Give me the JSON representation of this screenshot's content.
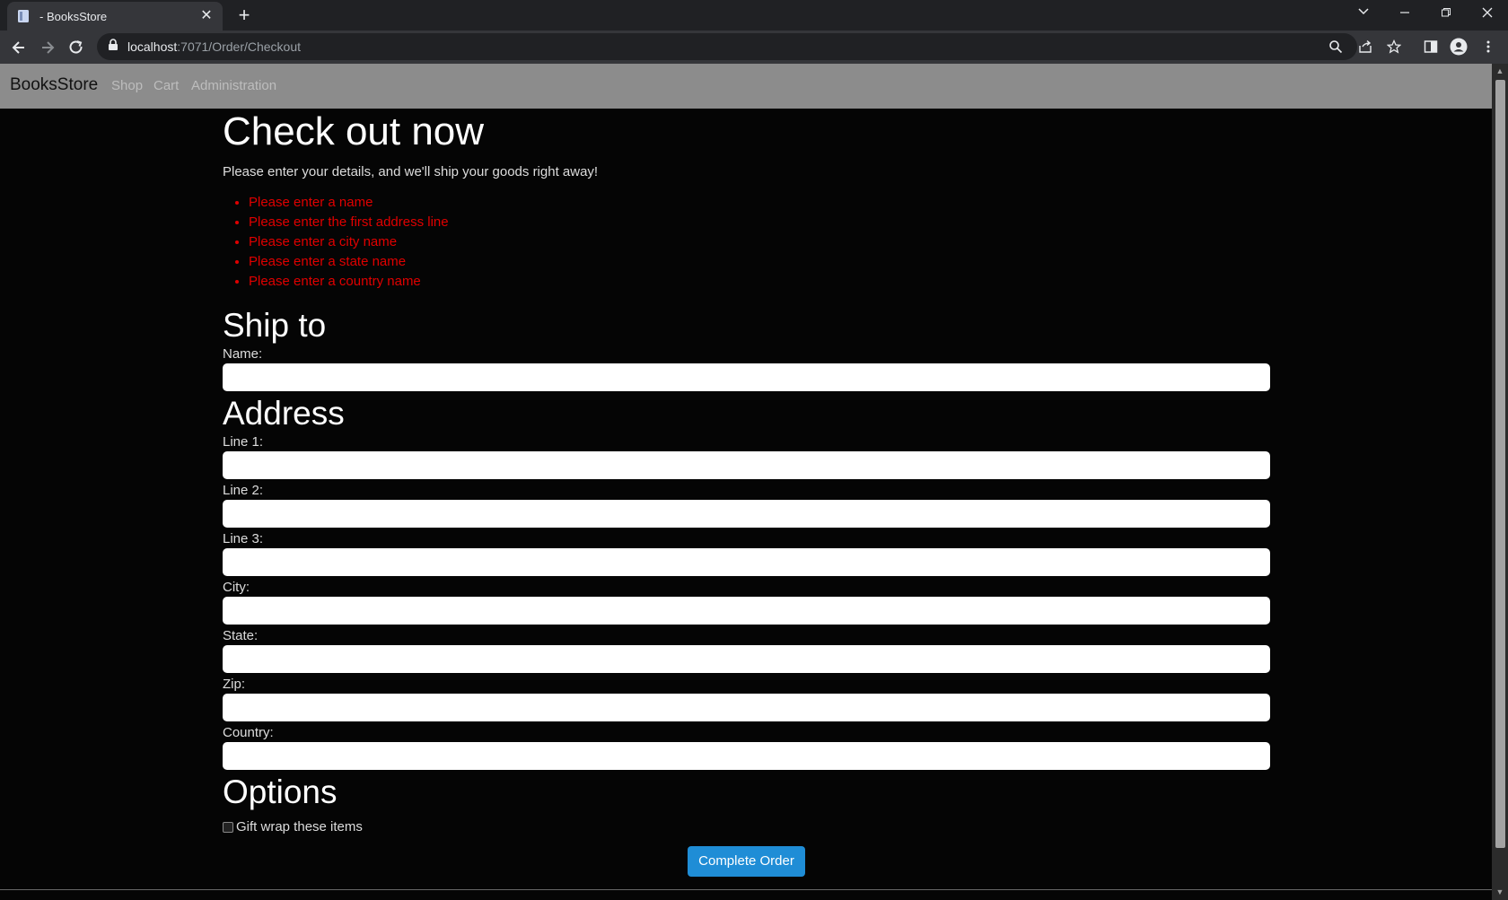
{
  "browser": {
    "tab_title": "- BooksStore",
    "tab_close": "✕",
    "new_tab": "+",
    "url_host": "localhost",
    "url_rest": ":7071/Order/Checkout"
  },
  "nav": {
    "brand": "BooksStore",
    "links": [
      "Shop",
      "Cart",
      "Administration"
    ]
  },
  "page": {
    "title": "Check out now",
    "intro": "Please enter your details, and we'll ship your goods right away!",
    "errors": [
      "Please enter a name",
      "Please enter the first address line",
      "Please enter a city name",
      "Please enter a state name",
      "Please enter a country name"
    ],
    "ship_to": {
      "heading": "Ship to",
      "name_label": "Name:",
      "name_value": ""
    },
    "address": {
      "heading": "Address",
      "line1_label": "Line 1:",
      "line2_label": "Line 2:",
      "line3_label": "Line 3:",
      "city_label": "City:",
      "state_label": "State:",
      "zip_label": "Zip:",
      "country_label": "Country:"
    },
    "options": {
      "heading": "Options",
      "giftwrap_label": "Gift wrap these items",
      "giftwrap_checked": false
    },
    "submit_label": "Complete Order"
  },
  "colors": {
    "error": "#e00000",
    "nav_bg": "#8c8c8c",
    "button": "#1f8dd6"
  }
}
